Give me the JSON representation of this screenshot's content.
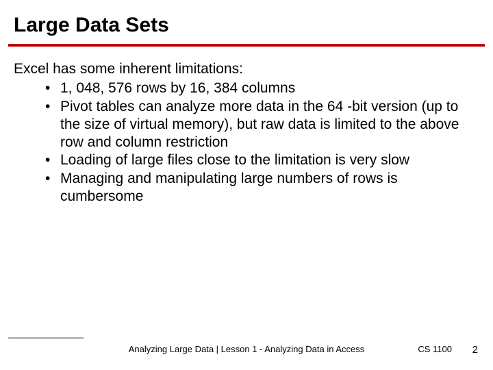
{
  "title": "Large Data Sets",
  "intro": "Excel has some inherent limitations:",
  "bullets": [
    "1, 048, 576 rows by 16, 384 columns",
    "Pivot tables can analyze more data in the 64 -bit version (up to the size of virtual memory), but raw data is limited to the above row and column restriction",
    "Loading of large files close to the limitation is very slow",
    "Managing and manipulating large numbers of rows is cumbersome"
  ],
  "footer": "Analyzing Large Data | Lesson 1 - Analyzing Data in Access",
  "course": "CS 1100",
  "page": "2"
}
